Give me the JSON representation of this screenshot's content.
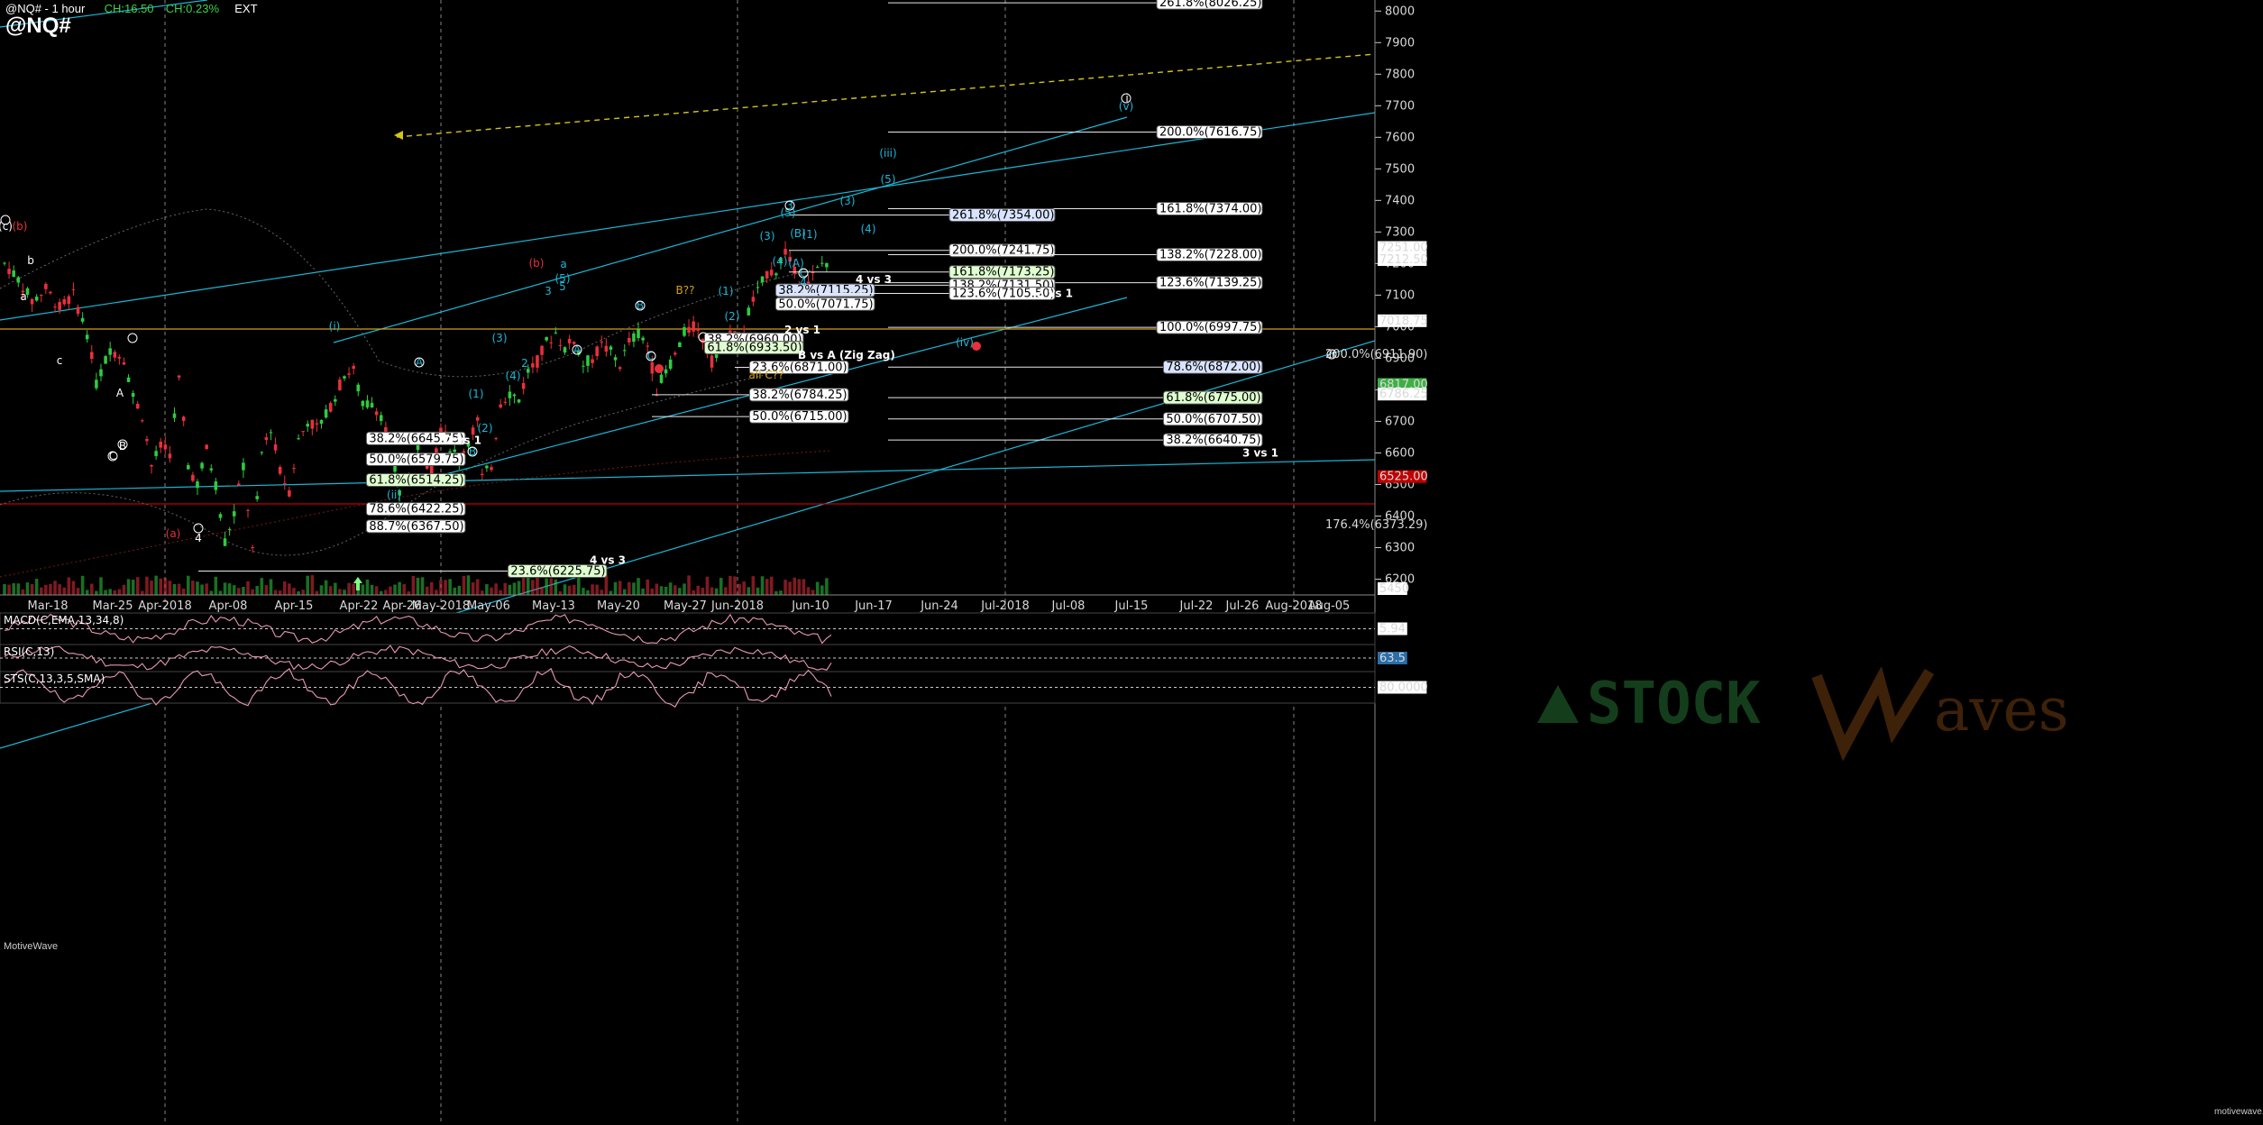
{
  "header": {
    "symbol_line": "@NQ# - 1 hour",
    "change_abs": "CH:16.50",
    "change_pct": "CH:0.23%",
    "session": "EXT",
    "big_symbol": "@NQ#"
  },
  "branding": {
    "motivewave": "MotiveWave",
    "motivewave_small": "motivewave.com",
    "watermark_a": "STOCK",
    "watermark_b": "aves"
  },
  "chart_data": {
    "type": "line",
    "subtype": "candlestick",
    "title": "@NQ# - 1 hour",
    "x_axis": [
      "Mar-18",
      "Mar-25",
      "Apr-2018",
      "Apr-08",
      "Apr-15",
      "Apr-22",
      "Apr-26",
      "May-2018",
      "May-06",
      "May-13",
      "May-20",
      "May-27",
      "Jun-2018",
      "Jun-10",
      "Jun-17",
      "Jun-24",
      "Jul-2018",
      "Jul-08",
      "Jul-15",
      "Jul-22",
      "Jul-26",
      "Aug-2018",
      "Aug-05"
    ],
    "y_ticks": [
      6200,
      6300,
      6400,
      6500,
      6600,
      6700,
      6800,
      6900,
      7000,
      7100,
      7200,
      7300,
      7400,
      7500,
      7600,
      7700,
      7800,
      7900,
      8000
    ],
    "ylim": [
      6150,
      8035
    ],
    "price_path": [
      [
        0,
        7200
      ],
      [
        3,
        7150
      ],
      [
        6,
        7080
      ],
      [
        9,
        7120
      ],
      [
        12,
        7060
      ],
      [
        15,
        7100
      ],
      [
        18,
        6980
      ],
      [
        20,
        6820
      ],
      [
        23,
        6930
      ],
      [
        26,
        6900
      ],
      [
        28,
        6780
      ],
      [
        30,
        6720
      ],
      [
        32,
        6560
      ],
      [
        34,
        6620
      ],
      [
        36,
        6600
      ],
      [
        38,
        6830
      ],
      [
        40,
        6560
      ],
      [
        42,
        6500
      ],
      [
        44,
        6610
      ],
      [
        46,
        6500
      ],
      [
        48,
        6320
      ],
      [
        50,
        6410
      ],
      [
        52,
        6560
      ],
      [
        54,
        6290
      ],
      [
        56,
        6600
      ],
      [
        58,
        6680
      ],
      [
        60,
        6540
      ],
      [
        62,
        6480
      ],
      [
        64,
        6640
      ],
      [
        66,
        6700
      ],
      [
        68,
        6680
      ],
      [
        70,
        6720
      ],
      [
        72,
        6780
      ],
      [
        74,
        6850
      ],
      [
        76,
        6860
      ],
      [
        78,
        6750
      ],
      [
        80,
        6760
      ],
      [
        82,
        6720
      ],
      [
        84,
        6620
      ],
      [
        86,
        6470
      ],
      [
        87,
        6420
      ],
      [
        89,
        6640
      ],
      [
        91,
        6600
      ],
      [
        93,
        6540
      ],
      [
        95,
        6680
      ],
      [
        97,
        6620
      ],
      [
        99,
        6580
      ],
      [
        101,
        6640
      ],
      [
        103,
        6700
      ],
      [
        104,
        6520
      ],
      [
        106,
        6560
      ],
      [
        108,
        6760
      ],
      [
        110,
        6790
      ],
      [
        112,
        6770
      ],
      [
        114,
        6860
      ],
      [
        116,
        6890
      ],
      [
        118,
        6950
      ],
      [
        120,
        6980
      ],
      [
        122,
        6930
      ],
      [
        124,
        6960
      ],
      [
        126,
        6880
      ],
      [
        128,
        6900
      ],
      [
        130,
        6940
      ],
      [
        132,
        6920
      ],
      [
        134,
        6880
      ],
      [
        136,
        6950
      ],
      [
        138,
        6980
      ],
      [
        140,
        6940
      ],
      [
        142,
        6800
      ],
      [
        144,
        6860
      ],
      [
        146,
        6910
      ],
      [
        148,
        6980
      ],
      [
        150,
        7000
      ],
      [
        152,
        6960
      ],
      [
        154,
        6890
      ],
      [
        156,
        6940
      ],
      [
        158,
        6980
      ],
      [
        160,
        6960
      ],
      [
        162,
        7050
      ],
      [
        164,
        7110
      ],
      [
        166,
        7170
      ],
      [
        168,
        7180
      ],
      [
        170,
        7240
      ],
      [
        172,
        7170
      ],
      [
        174,
        7110
      ],
      [
        176,
        7160
      ],
      [
        178,
        7200
      ],
      [
        180,
        7210
      ]
    ],
    "bar_count": 180,
    "fib_levels": [
      {
        "label": "261.8%(8026.25)",
        "price": 8026.25,
        "style": "white"
      },
      {
        "label": "200.0%(7616.75)",
        "price": 7616.75,
        "style": "white"
      },
      {
        "label": "161.8%(7374.00)",
        "price": 7374.0,
        "style": "white"
      },
      {
        "label": "261.8%(7354.00)",
        "price": 7354.0,
        "style": "blue"
      },
      {
        "label": "200.0%(7241.75)",
        "price": 7241.75,
        "style": "white"
      },
      {
        "label": "138.2%(7228.00)",
        "price": 7228.0,
        "style": "white"
      },
      {
        "label": "161.8%(7173.25)",
        "price": 7173.25,
        "style": "green"
      },
      {
        "label": "123.6%(7139.25)",
        "price": 7139.25,
        "style": "white"
      },
      {
        "label": "138.2%(7131.50)",
        "price": 7131.5,
        "style": "white"
      },
      {
        "label": "38.2%(7115.25)",
        "price": 7115.25,
        "style": "blue"
      },
      {
        "label": "123.6%(7105.50)",
        "price": 7105.5,
        "style": "white"
      },
      {
        "label": "50.0%(7071.75)",
        "price": 7071.75,
        "style": "white"
      },
      {
        "label": "100.0%(6997.75)",
        "price": 6997.75,
        "style": "white"
      },
      {
        "label": "38.2%(6960.00)",
        "price": 6960.0,
        "style": "white"
      },
      {
        "label": "61.8%(6933.50)",
        "price": 6933.5,
        "style": "green"
      },
      {
        "label": "23.6%(6871.00)",
        "price": 6871.0,
        "style": "white"
      },
      {
        "label": "78.6%(6872.00)",
        "price": 6872.0,
        "style": "blue"
      },
      {
        "label": "38.2%(6784.25)",
        "price": 6784.25,
        "style": "white"
      },
      {
        "label": "61.8%(6775.00)",
        "price": 6775.0,
        "style": "green"
      },
      {
        "label": "50.0%(6715.00)",
        "price": 6715.0,
        "style": "white"
      },
      {
        "label": "50.0%(6707.50)",
        "price": 6707.5,
        "style": "white"
      },
      {
        "label": "38.2%(6645.75)",
        "price": 6645.75,
        "style": "white"
      },
      {
        "label": "38.2%(6640.75)",
        "price": 6640.75,
        "style": "white"
      },
      {
        "label": "50.0%(6579.75)",
        "price": 6579.75,
        "style": "white"
      },
      {
        "label": "61.8%(6514.25)",
        "price": 6514.25,
        "style": "green"
      },
      {
        "label": "78.6%(6422.25)",
        "price": 6422.25,
        "style": "white"
      },
      {
        "label": "88.7%(6367.50)",
        "price": 6367.5,
        "style": "white"
      },
      {
        "label": "23.6%(6225.75)",
        "price": 6225.75,
        "style": "green"
      }
    ],
    "notes": [
      {
        "text": "4 vs 3",
        "price": 7150
      },
      {
        "text": "3 vs 1",
        "price": 7105
      },
      {
        "text": "2 vs 1",
        "price": 6990
      },
      {
        "text": "B vs A (Zig Zag)",
        "price": 6910
      },
      {
        "text": "2 vs 1",
        "price": 6640
      },
      {
        "text": "4 vs 3",
        "price": 6260
      },
      {
        "text": "3 vs 1",
        "price": 6600
      }
    ],
    "wave_labels": [
      "(c)",
      "(b)",
      "b",
      "a",
      "c",
      "A",
      "B",
      "C",
      "(a)",
      "4",
      "(i)",
      "(ii)",
      "(iii)",
      "(iv)",
      "(v)",
      "1",
      "2",
      "3",
      "4",
      "5",
      "(1)",
      "(2)",
      "(3)",
      "(4)",
      "(5)",
      "B??",
      "all C??",
      "i",
      "ii",
      "iii",
      "iv",
      "v"
    ],
    "right_price_tags": [
      {
        "label": "7251.00",
        "price": 7251,
        "color": "#ffffff"
      },
      {
        "label": "7212.50",
        "price": 7212.5,
        "color": "#ffffff"
      },
      {
        "label": "7018.75",
        "price": 7018.75,
        "color": "#ffffff"
      },
      {
        "label": "200.0%(6911.90)",
        "price": 6911.9,
        "color": "#d4a017"
      },
      {
        "label": "6817.00",
        "price": 6817,
        "color": "#3cb043"
      },
      {
        "label": "6786.25",
        "price": 6786.25,
        "color": "#ffffff"
      },
      {
        "label": "6525.00",
        "price": 6525,
        "color": "#c00000"
      },
      {
        "label": "176.4%(6373.29)",
        "price": 6373.29,
        "color": "#c00000"
      },
      {
        "label": "5450",
        "price": 6170,
        "color": "#ffffff"
      }
    ],
    "indicators": [
      {
        "name": "MACD(C,EMA,13,34,8)",
        "value": "5.94"
      },
      {
        "name": "RSI(C,13)",
        "value": "63.5"
      },
      {
        "name": "STS(C,13,3,5,SMA)",
        "value": "80.0000"
      }
    ],
    "grid": true,
    "legend": "none"
  },
  "colors": {
    "background": "#000000",
    "up": "#2ecc40",
    "down": "#e8303c",
    "cyan": "#1ab8d8",
    "gold": "#d4a017",
    "red": "#c00000"
  }
}
